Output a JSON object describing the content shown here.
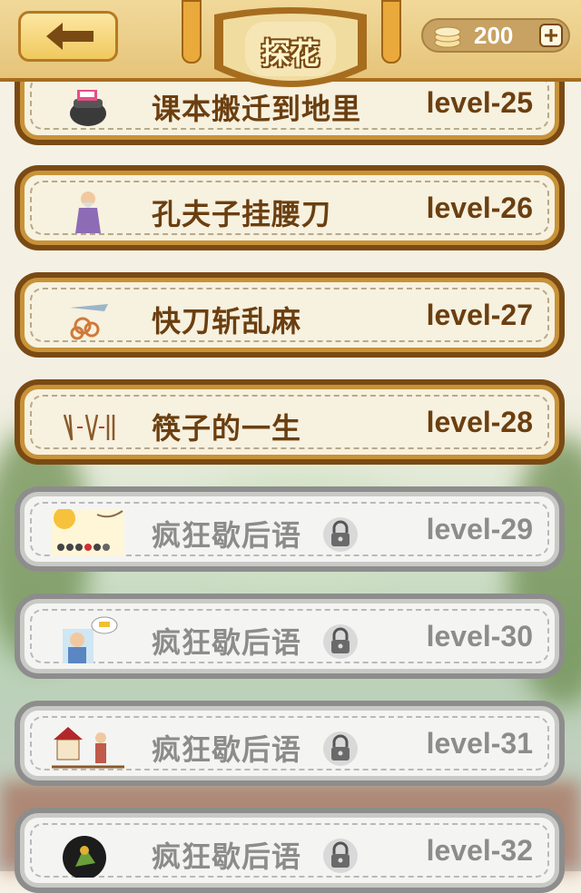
{
  "header": {
    "title": "探花",
    "coins": "200"
  },
  "levels": [
    {
      "title": "课本搬迁到地里",
      "level": "level-25",
      "locked": false
    },
    {
      "title": "孔夫子挂腰刀",
      "level": "level-26",
      "locked": false
    },
    {
      "title": "快刀斩乱麻",
      "level": "level-27",
      "locked": false
    },
    {
      "title": "筷子的一生",
      "level": "level-28",
      "locked": false
    },
    {
      "title": "疯狂歇后语",
      "level": "level-29",
      "locked": true
    },
    {
      "title": "疯狂歇后语",
      "level": "level-30",
      "locked": true
    },
    {
      "title": "疯狂歇后语",
      "level": "level-31",
      "locked": true
    },
    {
      "title": "疯狂歇后语",
      "level": "level-32",
      "locked": true
    }
  ],
  "icons": {
    "back": "back-arrow-icon",
    "coin": "coin-stack-icon",
    "plus": "plus-icon",
    "lock": "padlock-icon"
  },
  "colors": {
    "brown": "#6b3f10",
    "gold": "#e6c47a",
    "locked_gray": "#8c8c8c"
  }
}
